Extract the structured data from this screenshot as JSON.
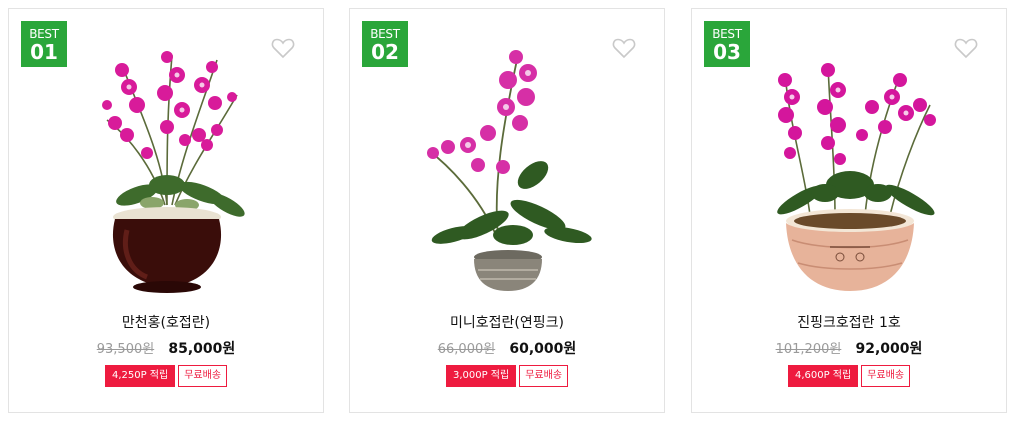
{
  "products": [
    {
      "badge_top": "BEST",
      "badge_rank": "01",
      "name": "만천홍(호접란)",
      "original_price": "93,500원",
      "sale_price": "85,000원",
      "point_tag": "4,250P 적립",
      "shipping_tag": "무료배송",
      "image_icon": "orchid-dark-pot-image",
      "favorite_icon": "heart-outline-icon"
    },
    {
      "badge_top": "BEST",
      "badge_rank": "02",
      "name": "미니호접란(연핑크)",
      "original_price": "66,000원",
      "sale_price": "60,000원",
      "point_tag": "3,000P 적립",
      "shipping_tag": "무료배송",
      "image_icon": "orchid-small-pot-image",
      "favorite_icon": "heart-outline-icon"
    },
    {
      "badge_top": "BEST",
      "badge_rank": "03",
      "name": "진핑크호접란 1호",
      "original_price": "101,200원",
      "sale_price": "92,000원",
      "point_tag": "4,600P 적립",
      "shipping_tag": "무료배송",
      "image_icon": "orchid-ceramic-bowl-image",
      "favorite_icon": "heart-outline-icon"
    }
  ],
  "colors": {
    "badge_green": "#2aa63a",
    "tag_red": "#ee1b3f",
    "flower_magenta": "#d81b9a"
  }
}
